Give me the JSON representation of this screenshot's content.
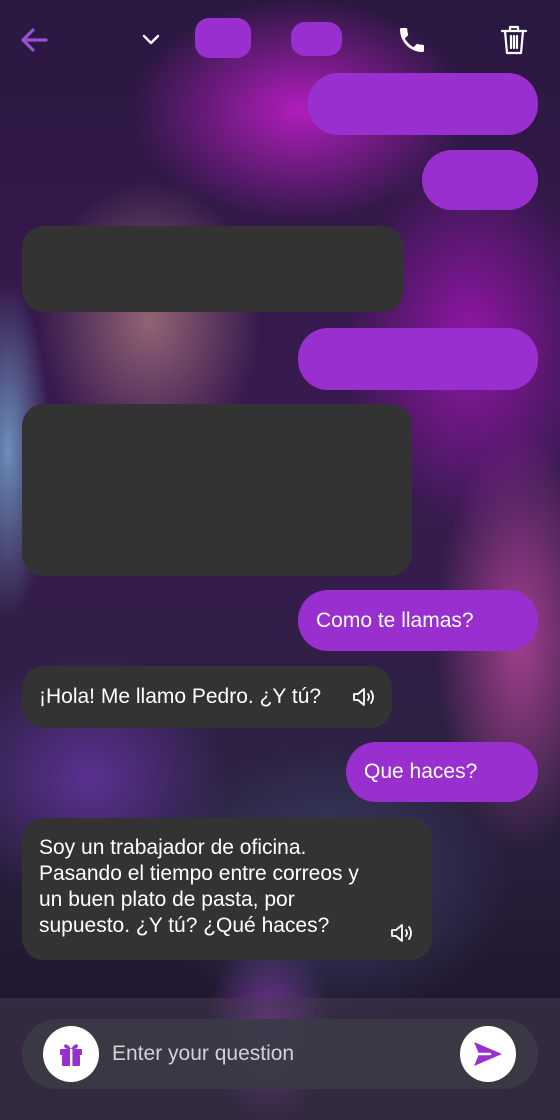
{
  "header": {
    "icons": {
      "back": "arrow-left-icon",
      "menu": "chevron-down-icon",
      "call": "phone-icon",
      "delete": "trash-icon"
    }
  },
  "messages": [
    {
      "role": "user",
      "text": ""
    },
    {
      "role": "user",
      "text": ""
    },
    {
      "role": "bot",
      "text": ""
    },
    {
      "role": "user",
      "text": ""
    },
    {
      "role": "bot",
      "text": ""
    },
    {
      "role": "user",
      "text": "Como te llamas?"
    },
    {
      "role": "bot",
      "text": "¡Hola! Me llamo Pedro. ¿Y tú?",
      "icon": "speaker-icon"
    },
    {
      "role": "user",
      "text": "Que haces?"
    },
    {
      "role": "bot",
      "text": "Soy un trabajador de oficina. Pasando el tiempo entre correos y un buen plato de pasta, por supuesto. ¿Y tú? ¿Qué haces?",
      "icon": "speaker-icon"
    }
  ],
  "composer": {
    "placeholder": "Enter your question",
    "value": "",
    "gift_icon": "gift-icon",
    "send_icon": "send-icon"
  },
  "colors": {
    "accent": "#9a2fcf",
    "user_bubble": "#9a2fcf",
    "bot_bubble": "#333333",
    "header_back": "#9b4fd1"
  }
}
